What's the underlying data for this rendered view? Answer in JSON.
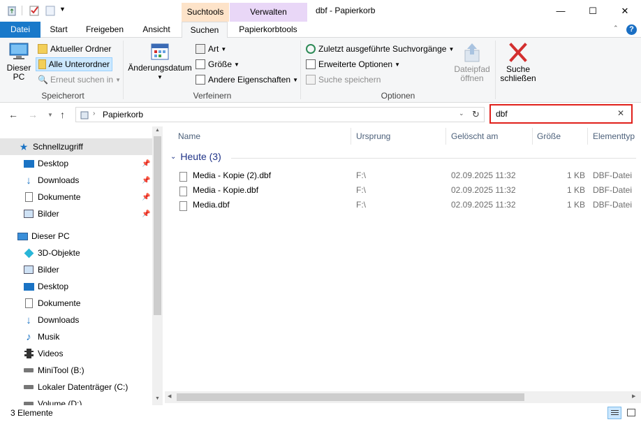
{
  "window": {
    "title": "dbf - Papierkorb",
    "context_search": "Suchtools",
    "context_manage": "Verwalten",
    "minimize": "—",
    "maximize": "☐",
    "close": "✕",
    "help": "?"
  },
  "tabs": {
    "datei": "Datei",
    "start": "Start",
    "freigeben": "Freigeben",
    "ansicht": "Ansicht",
    "suchen": "Suchen",
    "papierkorbtools": "Papierkorbtools"
  },
  "ribbon": {
    "speicherort": {
      "label": "Speicherort",
      "dieser_pc_1": "Dieser",
      "dieser_pc_2": "PC",
      "aktueller_ordner": "Aktueller Ordner",
      "alle_unterordner": "Alle Unterordner",
      "erneut_suchen": "Erneut suchen in"
    },
    "verfeinern": {
      "label": "Verfeinern",
      "aenderungsdatum": "Änderungsdatum",
      "art": "Art",
      "groesse": "Größe",
      "andere": "Andere Eigenschaften"
    },
    "optionen": {
      "label": "Optionen",
      "zuletzt": "Zuletzt ausgeführte Suchvorgänge",
      "erweiterte": "Erweiterte Optionen",
      "speichern": "Suche speichern",
      "dateipfad_1": "Dateipfad",
      "dateipfad_2": "öffnen",
      "schliessen_1": "Suche",
      "schliessen_2": "schließen"
    }
  },
  "address": {
    "path": "Papierkorb",
    "search_value": "dbf"
  },
  "nav": {
    "schnellzugriff": "Schnellzugriff",
    "quick": [
      "Desktop",
      "Downloads",
      "Dokumente",
      "Bilder"
    ],
    "dieser_pc": "Dieser PC",
    "pc": [
      "3D-Objekte",
      "Bilder",
      "Desktop",
      "Dokumente",
      "Downloads",
      "Musik",
      "Videos",
      "MiniTool (B:)",
      "Lokaler Datenträger (C:)",
      "Volume (D:)"
    ]
  },
  "columns": {
    "name": "Name",
    "ursprung": "Ursprung",
    "geloescht": "Gelöscht am",
    "groesse": "Größe",
    "elementtyp": "Elementtyp"
  },
  "group": {
    "label": "Heute (3)"
  },
  "files": [
    {
      "name": "Media - Kopie (2).dbf",
      "origin": "F:\\",
      "deleted": "02.09.2025 11:32",
      "size": "1 KB",
      "type": "DBF-Datei"
    },
    {
      "name": "Media - Kopie.dbf",
      "origin": "F:\\",
      "deleted": "02.09.2025 11:32",
      "size": "1 KB",
      "type": "DBF-Datei"
    },
    {
      "name": "Media.dbf",
      "origin": "F:\\",
      "deleted": "02.09.2025 11:32",
      "size": "1 KB",
      "type": "DBF-Datei"
    }
  ],
  "status": {
    "count": "3 Elemente"
  }
}
